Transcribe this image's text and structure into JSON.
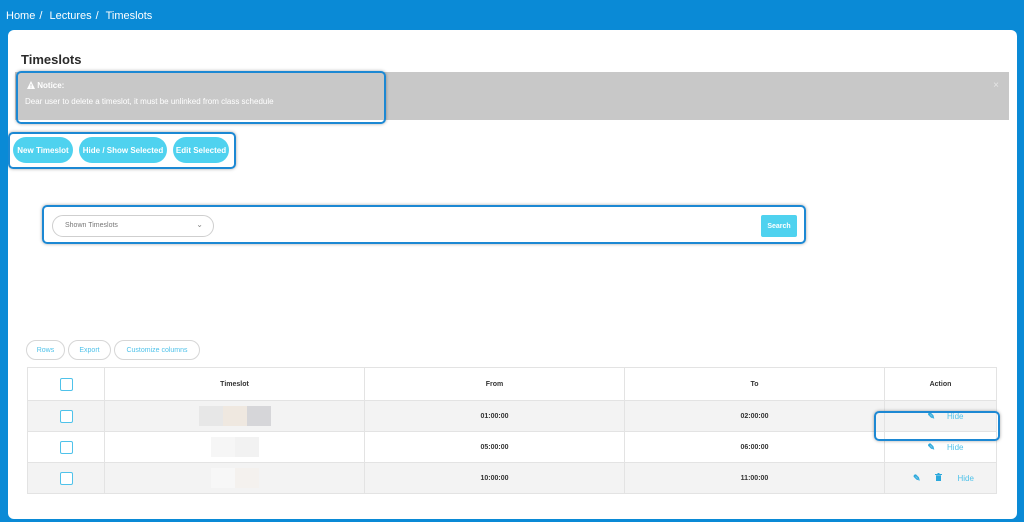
{
  "breadcrumb": {
    "home": "Home",
    "sep1": "/",
    "lectures": "Lectures",
    "sep2": "/",
    "current": "Timeslots"
  },
  "page": {
    "title": "Timeslots"
  },
  "notice": {
    "title": "Notice:",
    "icon": "warning-icon",
    "text": "Dear user to delete a timeslot, it must be unlinked from class schedule",
    "close": "×"
  },
  "actions": {
    "new_timeslot": "New Timeslot",
    "hide_show_selected": "Hide / Show Selected",
    "edit_selected": "Edit Selected"
  },
  "filter": {
    "select_value": "Shown Timeslots",
    "chevron": "⌄",
    "search_label": "Search"
  },
  "toolbar": {
    "rows": "Rows",
    "export": "Export",
    "customize_columns": "Customize columns"
  },
  "table": {
    "headers": {
      "timeslot": "Timeslot",
      "from": "From",
      "to": "To",
      "action": "Action"
    },
    "rows": [
      {
        "from": "01:00:00",
        "to": "02:00:00",
        "action_hide": "Hide"
      },
      {
        "from": "05:00:00",
        "to": "06:00:00",
        "action_hide": "Hide"
      },
      {
        "from": "10:00:00",
        "to": "11:00:00",
        "action_hide": "Hide"
      }
    ]
  },
  "colors": {
    "top_bar": "#0a8ad6",
    "accent": "#4fd2ef",
    "notice_bg": "#c8c8c8",
    "highlight": "#1c88d3"
  }
}
